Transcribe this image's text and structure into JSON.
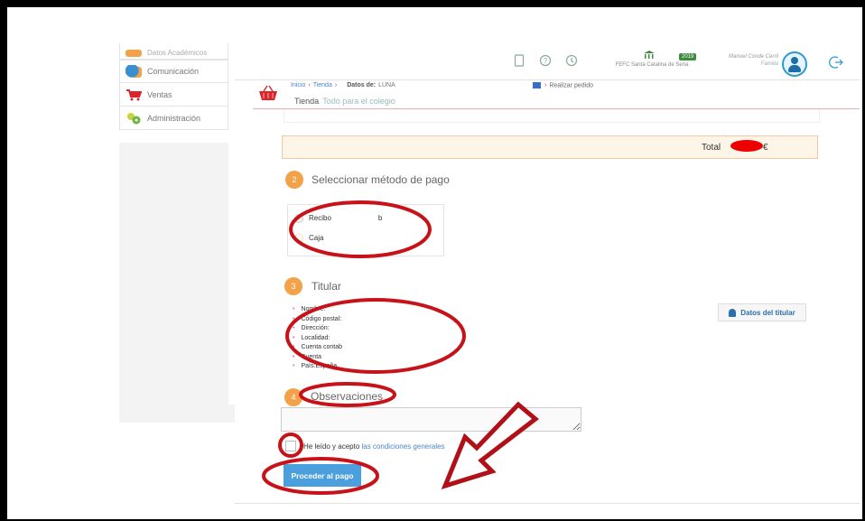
{
  "sidebar": {
    "items": [
      {
        "label": "Datos Académicos",
        "icon": "academic-icon",
        "color": "#f3a24a"
      },
      {
        "label": "Comunicación",
        "icon": "chat-bubbles-icon",
        "color": "#3a8fd0"
      },
      {
        "label": "Ventas",
        "icon": "cart-icon",
        "color": "#d9262c"
      },
      {
        "label": "Administración",
        "icon": "gears-icon",
        "color": "#6cb33f"
      }
    ]
  },
  "topbar": {
    "school_name": "FEFC Santa Catalina de Sena",
    "year_badge": "2019",
    "user_name": "Manuel Conde Cerril",
    "user_role": "Familia"
  },
  "breadcrumb": {
    "inicio": "Inicio",
    "tienda": "Tienda",
    "datos_label": "Datos de:",
    "datos_value": "LUNA",
    "realizar": "Realizar pedido"
  },
  "page": {
    "tienda_label": "Tienda",
    "tienda_sub": "Todo para el colegio"
  },
  "total": {
    "label": "Total",
    "currency": "€"
  },
  "payment": {
    "step": "2",
    "title": "Seleccionar método de pago",
    "options": [
      {
        "label": "Recibo",
        "extra": "b"
      },
      {
        "label": "Caja",
        "extra": ""
      }
    ]
  },
  "holder": {
    "step": "3",
    "title": "Titular",
    "fields": [
      "Nombre:",
      "Código postal:",
      "Dirección:",
      "Localidad:",
      "Cuenta contab",
      "Cuenta",
      "País:España"
    ],
    "button_label": "Datos del titular"
  },
  "observations": {
    "step": "4",
    "title": "Observaciones"
  },
  "terms": {
    "prefix": "He leído y acepto",
    "link": "las condiciones generales"
  },
  "submit": {
    "label": "Proceder al pago"
  },
  "colors": {
    "accent": "#4a9fdc",
    "step": "#f3a24a",
    "annotation": "#c8121a"
  }
}
